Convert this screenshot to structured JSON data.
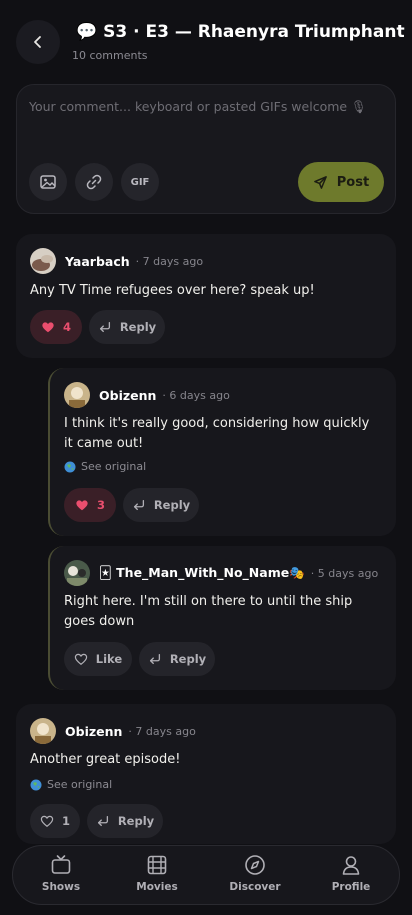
{
  "header": {
    "title": "💬 S3 · E3 — Rhaenyra Triumphant",
    "subtitle": "10 comments",
    "back_icon": "chevron-left-icon"
  },
  "composer": {
    "placeholder": "Your comment... keyboard or pasted GIFs welcome 🎙",
    "tools": [
      "image-icon",
      "link-icon"
    ],
    "gif_label": "GIF",
    "post_label": "Post",
    "post_icon": "send-icon"
  },
  "comments": [
    {
      "user": "Yaarbach",
      "time": "· 7 days ago",
      "text": "Any TV Time refugees over here? speak up!",
      "likes": "4",
      "liked": true,
      "reply_label": "Reply"
    },
    {
      "user": "Obizenn",
      "time": "· 6 days ago",
      "text": "I think it's really good, considering how quickly it came out!",
      "see_original": "See original",
      "likes": "3",
      "liked": true,
      "reply_label": "Reply"
    },
    {
      "user": "🃏 The_Man_With_No_Name🎭",
      "time": "· 5 days ago",
      "text": "Right here. I'm still on there to until the ship goes down",
      "like_label": "Like",
      "liked": false,
      "reply_label": "Reply"
    },
    {
      "user": "Obizenn",
      "time": "· 7 days ago",
      "text": "Another great episode!",
      "see_original": "See original",
      "likes": "1",
      "liked": false,
      "reply_label": "Reply"
    }
  ],
  "nav": {
    "items": [
      {
        "label": "Shows",
        "icon": "tv-icon"
      },
      {
        "label": "Movies",
        "icon": "film-icon"
      },
      {
        "label": "Discover",
        "icon": "compass-icon"
      },
      {
        "label": "Profile",
        "icon": "profile-icon"
      }
    ]
  },
  "colors": {
    "background": "#101014",
    "card": "#17171c",
    "accent": "#6e7a2c",
    "like": "#ea4e6e"
  }
}
